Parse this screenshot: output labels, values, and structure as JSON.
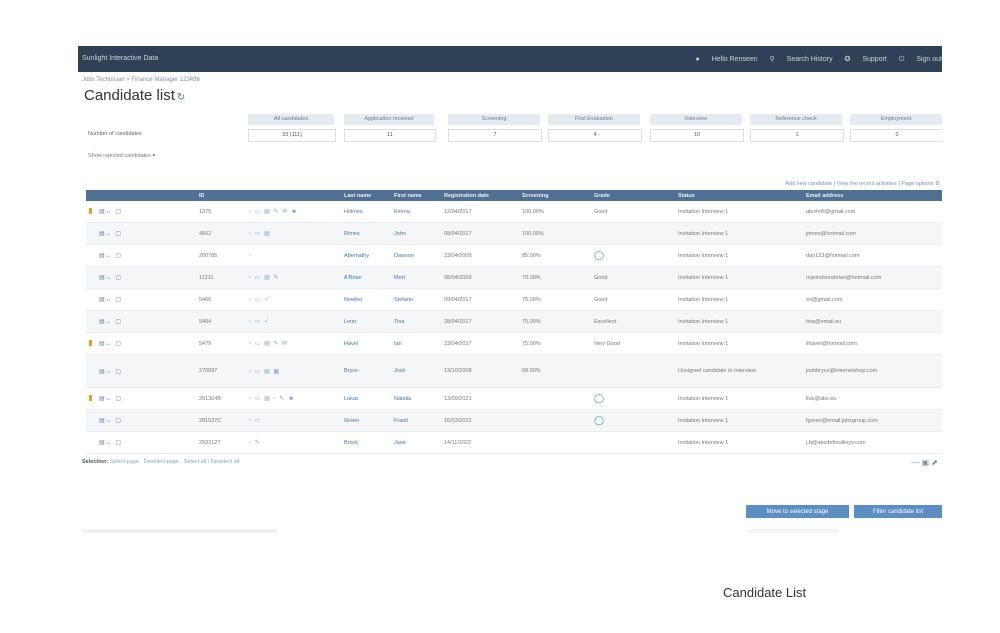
{
  "topbar": {
    "app_title": "Sunlight Interactive Data",
    "nav": [
      "Hello Renseen",
      "Search History",
      "Support",
      "Sign out"
    ]
  },
  "breadcrumb": "Jobs Technician > Finance Manager 123456",
  "page_title": "Candidate list",
  "summary": {
    "headers": [
      "All candidates",
      "Application received",
      "Screening",
      "First Evaluation",
      "Interview",
      "Reference check",
      "Employment"
    ],
    "row_label": "Number of candidates",
    "values": [
      "33 (111)",
      "11",
      "7",
      "4",
      "10",
      "1",
      "0"
    ],
    "link": "Show rejected candidates"
  },
  "grid_tools": "Add new candidate | View the recent activities | Page options",
  "table": {
    "headers": [
      "",
      "",
      "ID",
      "",
      "Last name",
      "First name",
      "Registration date",
      "Screening",
      "",
      "Grade",
      "Status",
      "Email address"
    ],
    "rows": [
      {
        "flag": true,
        "id": "1375",
        "icons": "▫ ▭ ▤ ✎ ✉ ☻",
        "last": "Holmes",
        "first": "Emma",
        "date": "12/04/2017",
        "score": "100.00%",
        "grade": "Good",
        "grade_circle": false,
        "status": "Invitation Interview 1",
        "email": "alexholl@gmail.com"
      },
      {
        "flag": false,
        "id": "4562",
        "icons": "▫ ▭ ▤",
        "last": "Rimes",
        "first": "John",
        "date": "08/04/2017",
        "score": "100.00%",
        "grade": "",
        "grade_circle": false,
        "status": "Invitation Interview 1",
        "email": "jrimes@hotmail.com"
      },
      {
        "flag": false,
        "id": "200785",
        "icons": "▫",
        "last": "Abernathy",
        "first": "Dawson",
        "date": "23/04/2009",
        "score": "85.00%",
        "grade": "",
        "grade_circle": true,
        "status": "Invitation Interview 1",
        "email": "dan123@hotmail.com"
      },
      {
        "flag": false,
        "id": "11211",
        "icons": "▫ ▭ ▤ ✎",
        "last": "A'Brian",
        "first": "Mert",
        "date": "08/04/2009",
        "score": "79.00%",
        "grade": "Good",
        "grade_circle": false,
        "status": "Invitation Interview 1",
        "email": "mjwindsorabrian@hotmail.com"
      },
      {
        "flag": false,
        "id": "5466",
        "icons": "▫ ▭ ✓",
        "last": "Newlen",
        "first": "Stefano",
        "date": "09/04/2017",
        "score": "75.00%",
        "grade": "Good",
        "grade_circle": false,
        "status": "Invitation Interview 1",
        "email": "sn@gmail.com"
      },
      {
        "flag": false,
        "id": "5404",
        "icons": "▫ ▭ ✓",
        "last": "Lenn",
        "first": "Tina",
        "date": "28/04/2017",
        "score": "75.00%",
        "grade": "Excellent",
        "grade_circle": false,
        "status": "Invitation Interview 1",
        "email": "tina@email.eu"
      },
      {
        "flag": true,
        "id": "5479",
        "icons": "▫ ▭ ▤ ✎ ✉",
        "last": "Havel",
        "first": "Ian",
        "date": "23/04/2017",
        "score": "75.00%",
        "grade": "Very Good",
        "grade_circle": false,
        "status": "Invitation Interview 1",
        "email": "ilhavel@hotmail.com"
      },
      {
        "flag": false,
        "id": "270897",
        "icons": "▫ ▭ ▤ ▦",
        "last": "Bryce",
        "first": "Josh",
        "date": "13/10/2008",
        "score": "68.00%",
        "grade": "",
        "grade_circle": false,
        "status": "Unsigned candidate to interview",
        "email": "joshbryce@internetshop.com",
        "tall": true
      },
      {
        "flag": true,
        "id": "291324B",
        "icons": "▫ ▭ ▤ ▫ ✎ ☻",
        "last": "Lukas",
        "first": "Natalia",
        "date": "13/09/2021",
        "score": "",
        "grade": "",
        "grade_circle": true,
        "status": "Invitation Interview 1",
        "email": "lluk@abc.eu"
      },
      {
        "flag": false,
        "id": "281537C",
        "icons": "▫ ▭",
        "last": "Green",
        "first": "Frank",
        "date": "16/03/2022",
        "score": "",
        "grade": "",
        "grade_circle": true,
        "status": "Invitation Interview 1",
        "email": "fgreen@email.jobsgroup.com"
      },
      {
        "flag": false,
        "id": "293312T",
        "icons": "▫ ✎",
        "last": "Brock",
        "first": "Jane",
        "date": "14/11/2022",
        "score": "",
        "grade": "",
        "grade_circle": false,
        "status": "Invitation Interview 1",
        "email": "j.b@abcdefmultisys.com"
      }
    ]
  },
  "footer": {
    "label": "Selection:",
    "links": [
      "Select page",
      "Deselect page",
      "Select all / Deselect all"
    ]
  },
  "paging": "— ▣ ⬈",
  "buttons": [
    "Move to selected stage",
    "Filter candidate list"
  ],
  "caption": "Candidate List"
}
